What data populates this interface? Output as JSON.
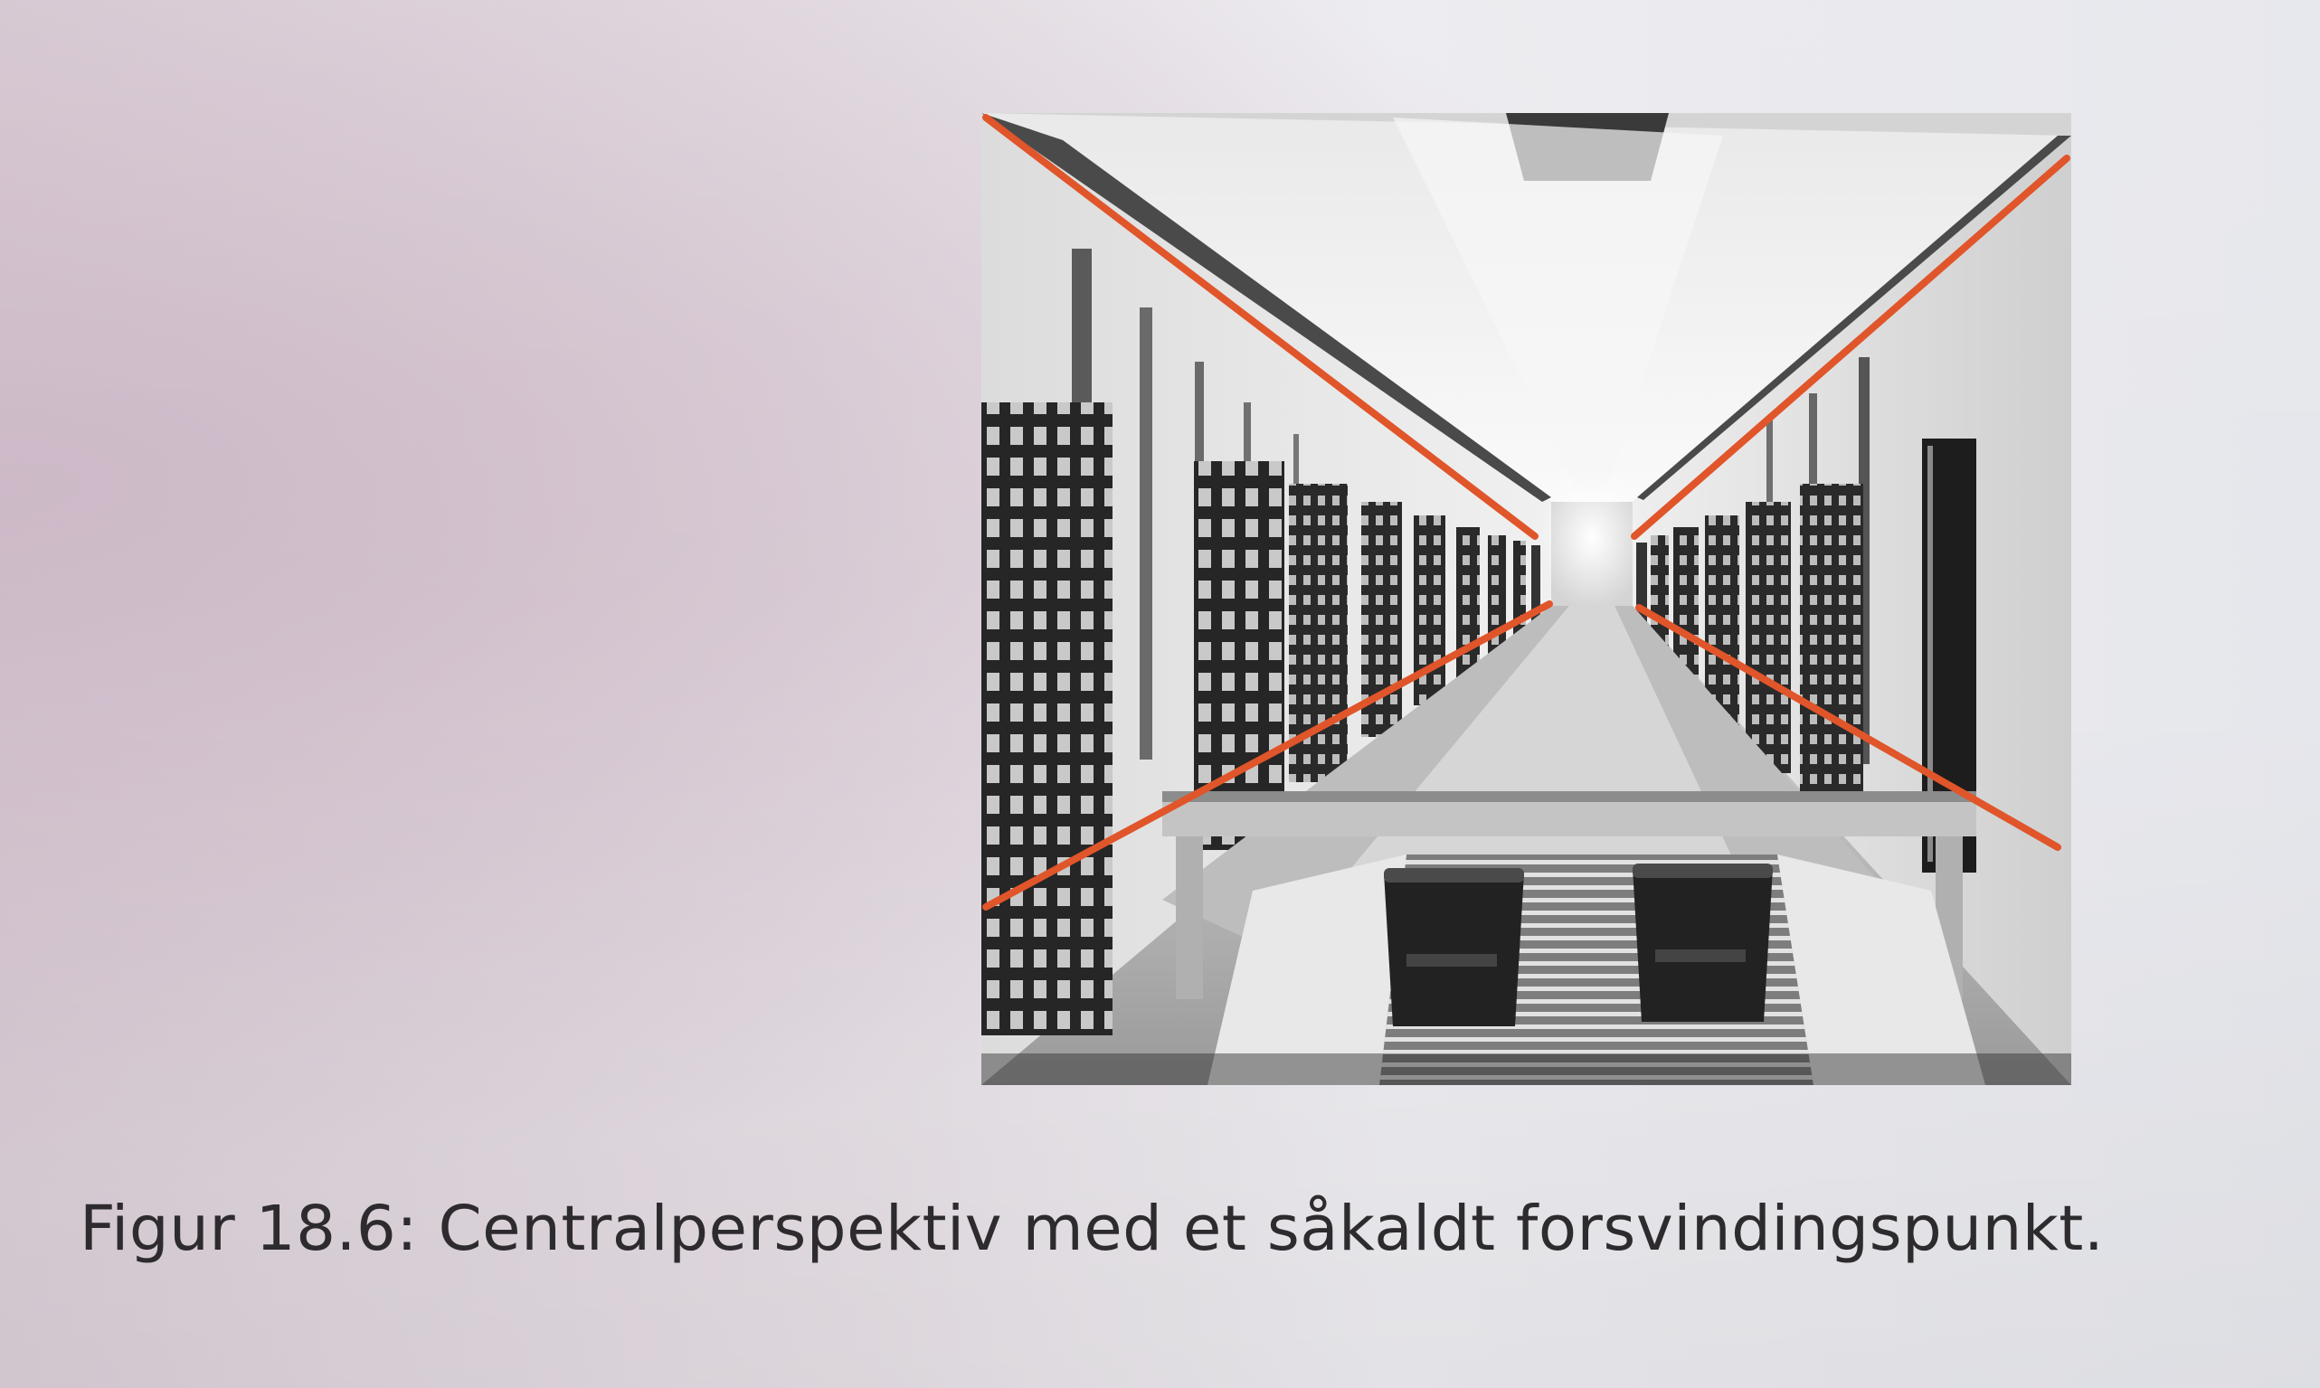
{
  "figure": {
    "caption": "Figur 18.6: Centralperspektiv med et såkaldt forsvindingspunkt.",
    "photo_subject": "prison corridor with cell doors and conveyor, black-and-white photograph",
    "overlay_line_color": "#e0552a",
    "overlay_lines_count": 4
  },
  "colors": {
    "page_background": "#e8e4e9",
    "caption_text": "#2e2b2e"
  }
}
